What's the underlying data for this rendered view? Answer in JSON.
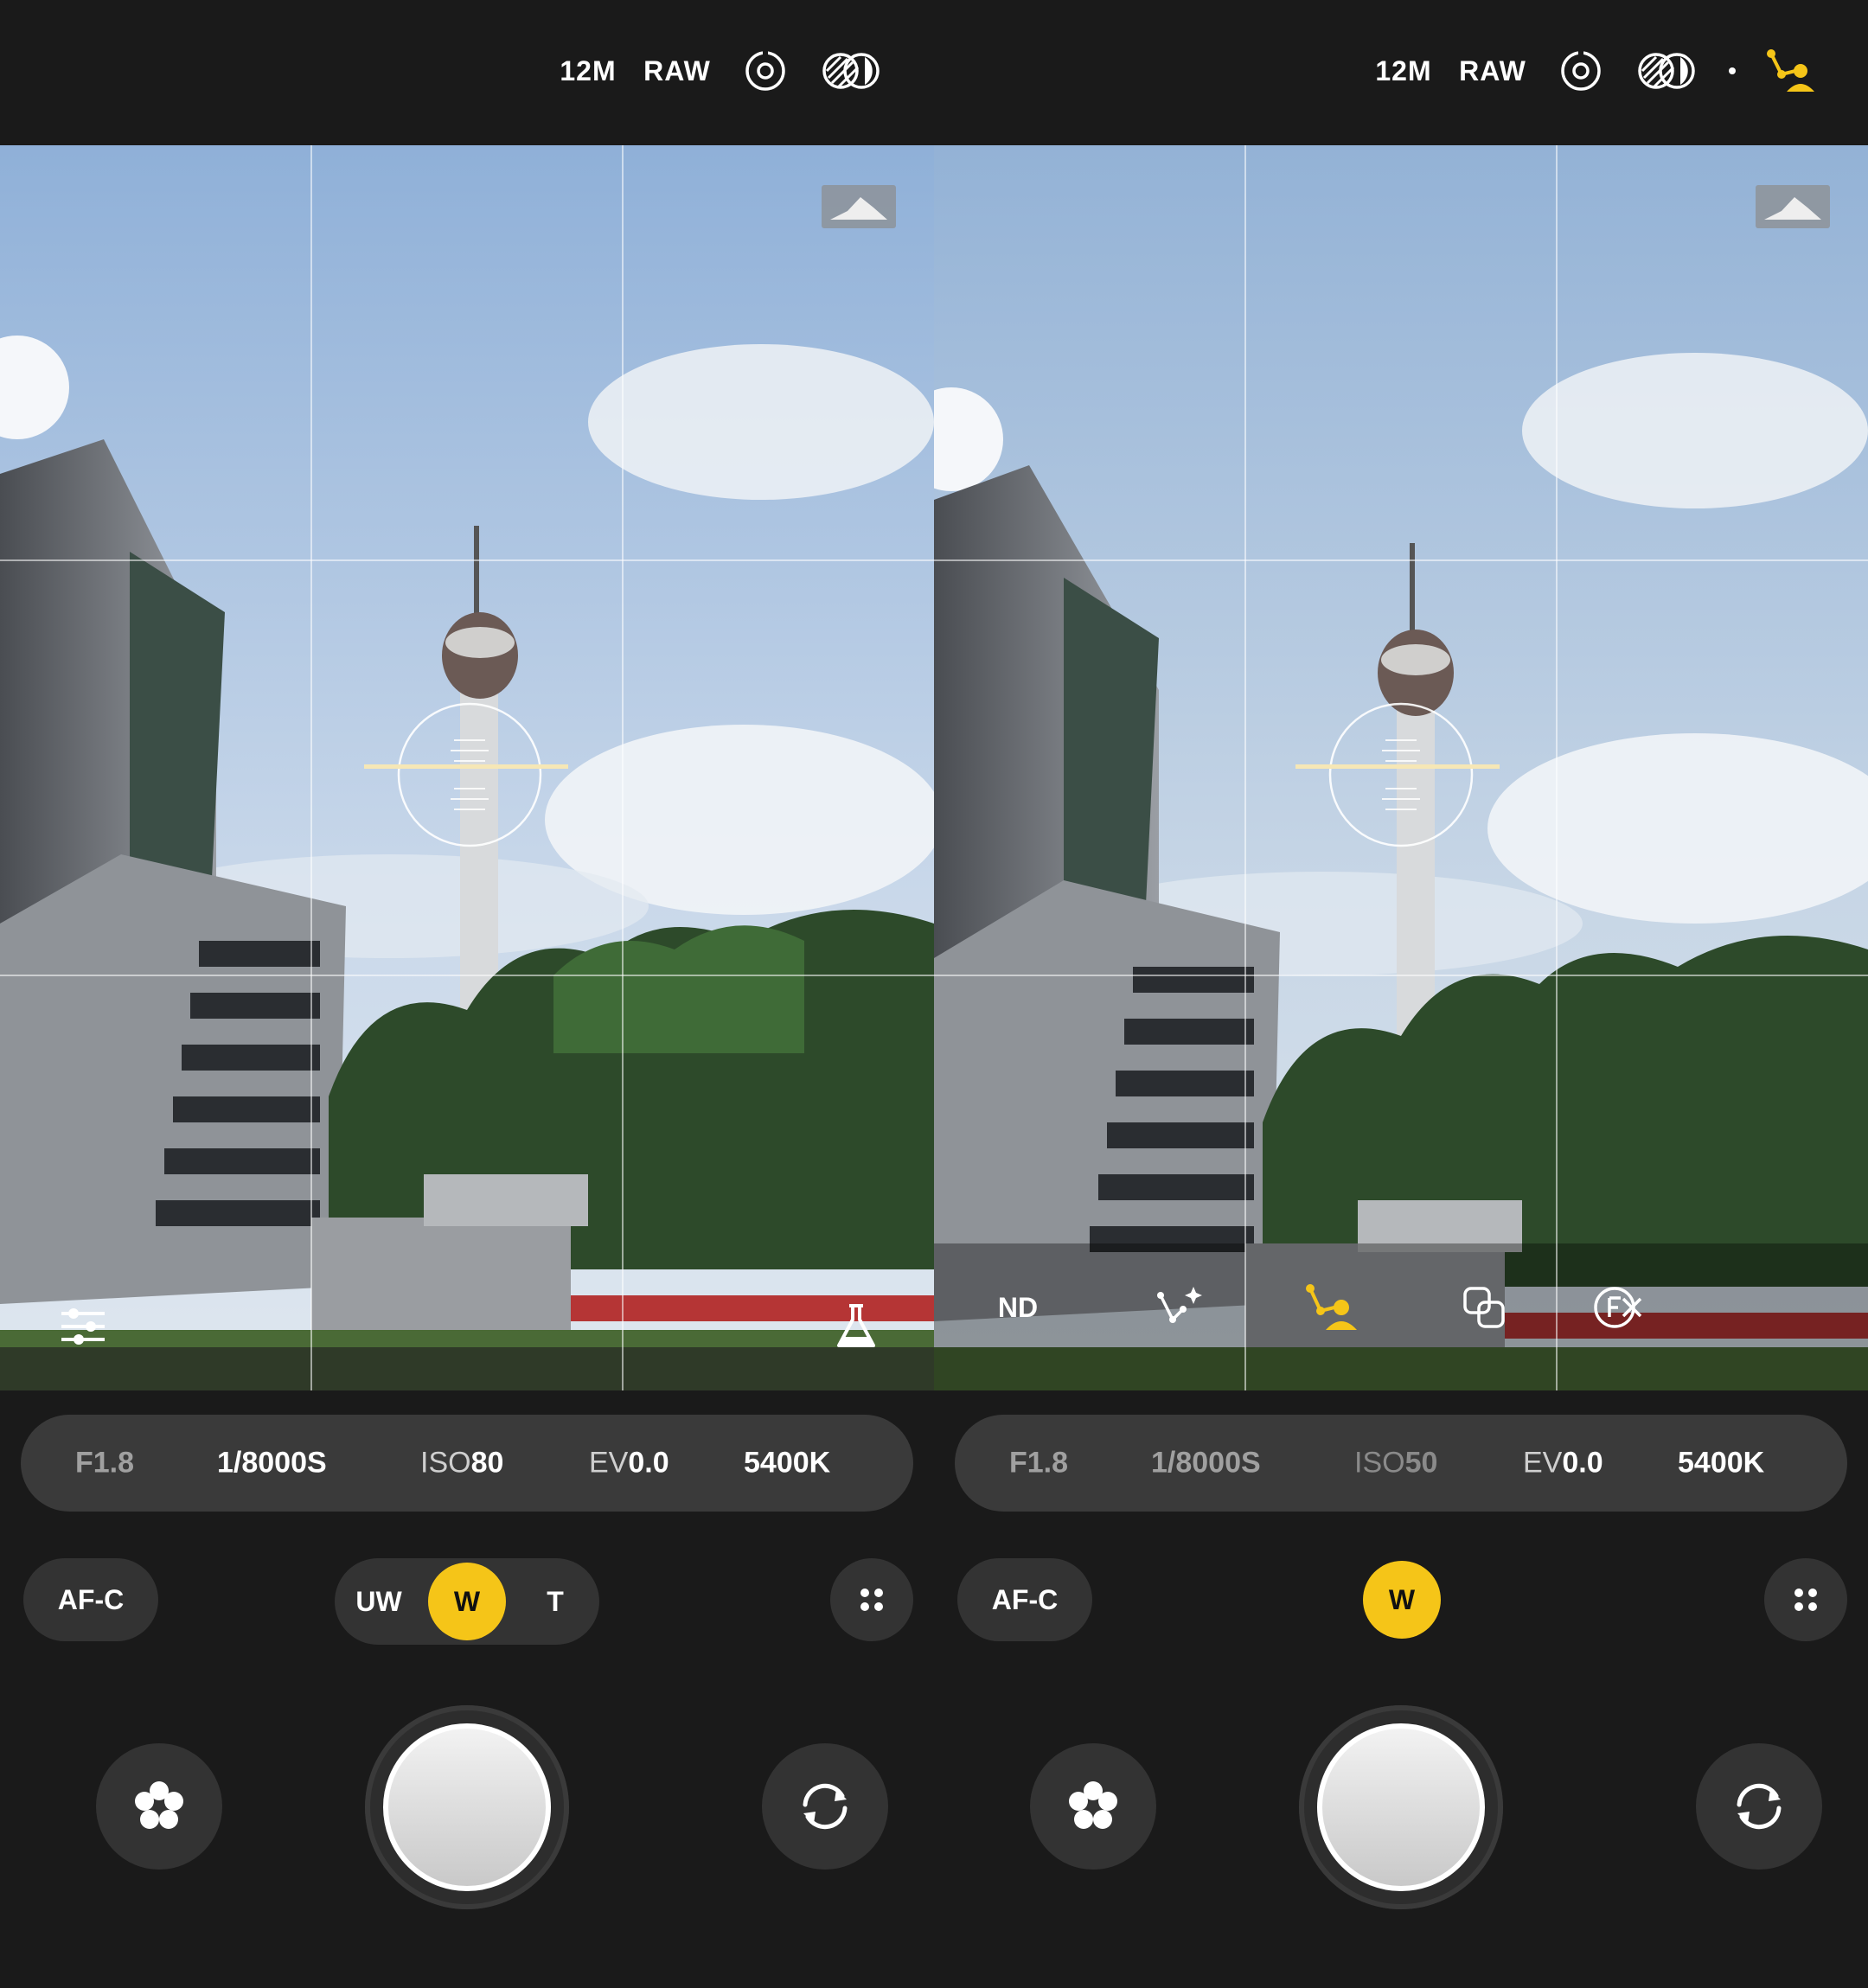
{
  "colors": {
    "accent": "#f5c518",
    "background": "#1a1a1a",
    "panel": "#3a3a3a",
    "button": "#333333"
  },
  "screens": [
    {
      "topbar": {
        "resolution": "12M",
        "format": "RAW",
        "icons": [
          "live-photo-icon",
          "color-filter-icon"
        ]
      },
      "viewfinder": {
        "tools": [
          "sliders-icon",
          "flask-icon"
        ]
      },
      "params": {
        "aperture": "F1.8",
        "shutter": "1/8000S",
        "iso_label": "ISO",
        "iso_value": "80",
        "ev_label": "EV",
        "ev_value": "0.0",
        "wb": "5400K"
      },
      "focus": "AF-C",
      "lenses": [
        "UW",
        "W",
        "T"
      ],
      "active_lens": "W"
    },
    {
      "topbar": {
        "resolution": "12M",
        "format": "RAW",
        "icons": [
          "live-photo-icon",
          "color-filter-icon",
          "portrait-tracking-icon"
        ]
      },
      "viewfinder": {
        "tools_text": {
          "nd": "ND"
        },
        "tools": [
          "f-circle-icon",
          "sparkle-points-icon",
          "portrait-tracking-icon",
          "multi-exposure-icon",
          "close-icon"
        ]
      },
      "params": {
        "aperture": "F1.8",
        "shutter": "1/8000S",
        "iso_label": "ISO",
        "iso_value": "50",
        "ev_label": "EV",
        "ev_value": "0.0",
        "wb": "5400K"
      },
      "focus": "AF-C",
      "lenses": [
        "W"
      ],
      "active_lens": "W"
    }
  ]
}
